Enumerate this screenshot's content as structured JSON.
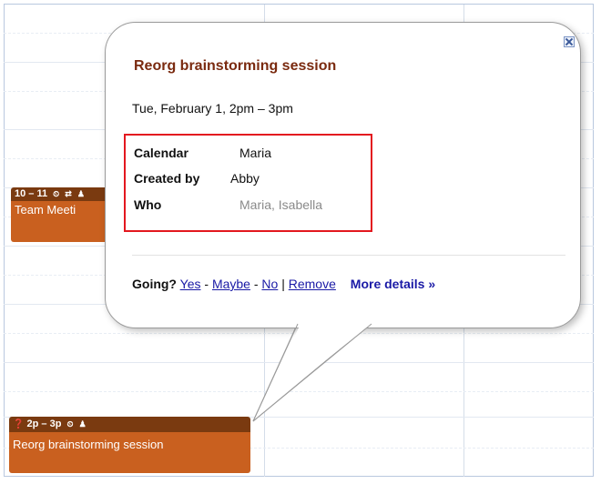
{
  "calendar": {
    "events": [
      {
        "time": "10 – 11",
        "title": "Team Meeti",
        "icons": [
          "reminder-icon",
          "repeat-icon",
          "guests-icon"
        ]
      },
      {
        "time": "2p – 3p",
        "title": "Reorg brainstorming session",
        "icons": [
          "question-icon",
          "reminder-icon",
          "guests-icon"
        ]
      }
    ]
  },
  "bubble": {
    "title": "Reorg brainstorming session",
    "when": "Tue, February 1, 2pm – 3pm",
    "details": {
      "calendar_label": "Calendar",
      "calendar_value": "Maria",
      "created_label": "Created by",
      "created_value": "Abby",
      "who_label": "Who",
      "who_value": "Maria, Isabella"
    },
    "actions": {
      "going_label": "Going?",
      "yes": "Yes",
      "maybe": "Maybe",
      "no": "No",
      "remove": "Remove",
      "more_details": "More details »",
      "sep_dash": "-",
      "sep_pipe": "|"
    }
  },
  "colors": {
    "event_head": "#7a3a10",
    "event_body": "#c9601f",
    "title": "#7a2a0f",
    "highlight_box": "#e3181f",
    "link": "#1a1aa6"
  }
}
